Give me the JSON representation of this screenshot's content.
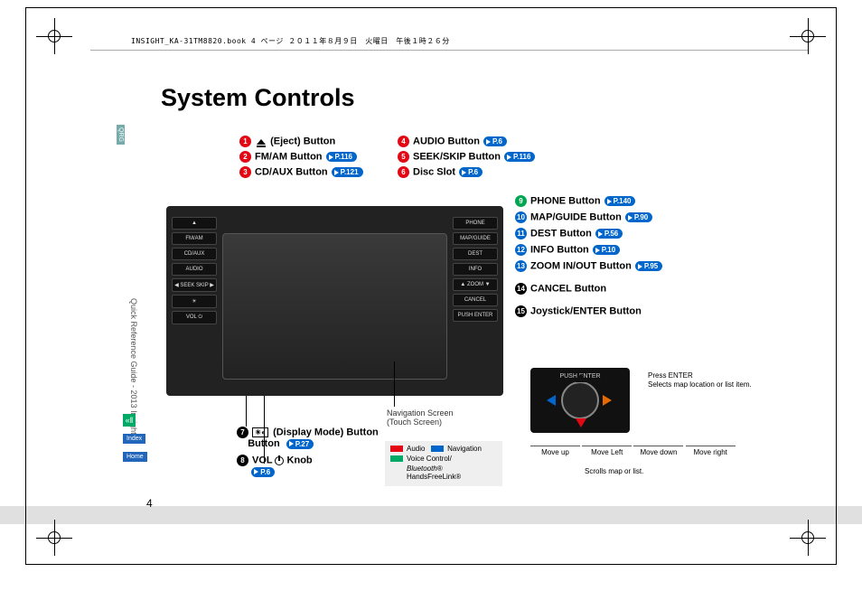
{
  "meta": {
    "header_line": "INSIGHT_KA-31TM8820.book  4 ページ  ２０１１年８月９日　火曜日　午後１時２６分",
    "title": "System Controls",
    "page_number": "4",
    "sidebar_vertical": "Quick Reference Guide - 2013 Insight",
    "sidebar_qrg": "QRG",
    "sidebar_index": "Index",
    "sidebar_home": "Home"
  },
  "top_left": [
    {
      "n": "1",
      "color": "red",
      "label": "(Eject) Button",
      "icon": "eject"
    },
    {
      "n": "2",
      "color": "red",
      "label": "FM/AM Button",
      "page": "P.116"
    },
    {
      "n": "3",
      "color": "red",
      "label": "CD/AUX Button",
      "page": "P.121"
    }
  ],
  "top_right": [
    {
      "n": "4",
      "color": "red",
      "label": "AUDIO Button",
      "page": "P.6"
    },
    {
      "n": "5",
      "color": "red",
      "label": "SEEK/SKIP Button",
      "page": "P.116"
    },
    {
      "n": "6",
      "color": "red",
      "label": "Disc Slot",
      "page": "P.6"
    }
  ],
  "right": [
    {
      "n": "9",
      "color": "green",
      "label": "PHONE Button",
      "page": "P.140"
    },
    {
      "n": "10",
      "color": "blue",
      "label": "MAP/GUIDE Button",
      "page": "P.90"
    },
    {
      "n": "11",
      "color": "blue",
      "label": "DEST Button",
      "page": "P.56"
    },
    {
      "n": "12",
      "color": "blue",
      "label": "INFO Button",
      "page": "P.10"
    },
    {
      "n": "13",
      "color": "blue",
      "label": "ZOOM IN/OUT Button",
      "page": "P.95"
    },
    {
      "n": "14",
      "color": "black",
      "label": "CANCEL Button"
    },
    {
      "n": "15",
      "color": "black",
      "label": "Joystick/ENTER Button"
    }
  ],
  "bottom": [
    {
      "n": "7",
      "color": "black",
      "icon": "display",
      "label": "(Display Mode) Button",
      "page": "P.27"
    },
    {
      "n": "8",
      "color": "black",
      "icon": "power",
      "label_prefix": "VOL",
      "label": "Knob",
      "page": "P.6"
    }
  ],
  "nav_caption": {
    "l1": "Navigation Screen",
    "l2": "(Touch Screen)"
  },
  "legend": {
    "audio": "Audio",
    "navigation": "Navigation",
    "voice_l1": "Voice Control/",
    "voice_l2_prefix": "Bluetooth",
    "voice_l2_suffix": "® HandsFreeLink®"
  },
  "joystick": {
    "photo_label": "PUSH\nENTER",
    "press_label": "Press ENTER",
    "press_desc": "Selects map location or list item.",
    "move_up": "Move up",
    "move_left": "Move Left",
    "move_down": "Move down",
    "move_right": "Move right",
    "scroll": "Scrolls map or list."
  },
  "dash_buttons": {
    "left": [
      "▲",
      "FM/AM",
      "CD/AUX",
      "AUDIO",
      "◀ SEEK SKIP ▶",
      "☀",
      "VOL ⏻"
    ],
    "right": [
      "PHONE",
      "MAP/GUIDE",
      "DEST",
      "INFO",
      "▲ ZOOM ▼",
      "CANCEL",
      "PUSH ENTER"
    ]
  }
}
